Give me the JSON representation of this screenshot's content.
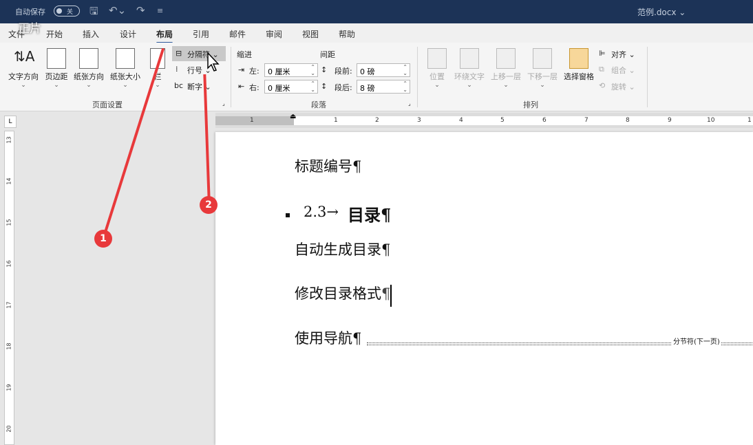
{
  "titlebar": {
    "autosave_label": "自动保存",
    "autosave_state": "关",
    "doc_name": "范例.docx ⌄",
    "quick_access": [
      "save-icon",
      "undo-icon",
      "redo-icon",
      "customize-icon"
    ]
  },
  "watermark": "正片",
  "tabs": [
    "文件",
    "开始",
    "插入",
    "设计",
    "布局",
    "引用",
    "邮件",
    "审阅",
    "视图",
    "帮助"
  ],
  "active_tab": "布局",
  "ribbon": {
    "page_setup": {
      "group_label": "页面设置",
      "buttons": [
        "文字方向",
        "页边距",
        "纸张方向",
        "纸张大小",
        "栏"
      ],
      "breaks": "分隔符 ⌄",
      "line_numbers": "行号 ⌄",
      "hyphenation": "断字 ⌄"
    },
    "paragraph": {
      "group_label": "段落",
      "indent_label": "缩进",
      "spacing_label": "间距",
      "left_label": "左:",
      "left_value": "0 厘米",
      "right_label": "右:",
      "right_value": "0 厘米",
      "before_label": "段前:",
      "before_value": "0 磅",
      "after_label": "段后:",
      "after_value": "8 磅"
    },
    "arrange": {
      "group_label": "排列",
      "buttons": [
        "位置",
        "环绕文字",
        "上移一层",
        "下移一层",
        "选择窗格"
      ],
      "align": "对齐 ⌄",
      "group": "组合 ⌄",
      "rotate": "旋转 ⌄"
    }
  },
  "ruler": {
    "h_numbers": [
      "1",
      "1",
      "2",
      "3",
      "4",
      "5",
      "6",
      "7",
      "8",
      "9",
      "10",
      "1"
    ],
    "v_numbers": [
      "13",
      "14",
      "15",
      "16",
      "17",
      "18",
      "19",
      "20"
    ]
  },
  "document": {
    "para1": "标题编号¶",
    "para2_number": "2.3→",
    "para2_text": "目录¶",
    "para3": "自动生成目录¶",
    "para4_text": "修改目录格式",
    "para4_mark": "¶",
    "para5": "使用导航¶",
    "section_break": "分节符(下一页)"
  },
  "annotations": [
    "1",
    "2"
  ]
}
